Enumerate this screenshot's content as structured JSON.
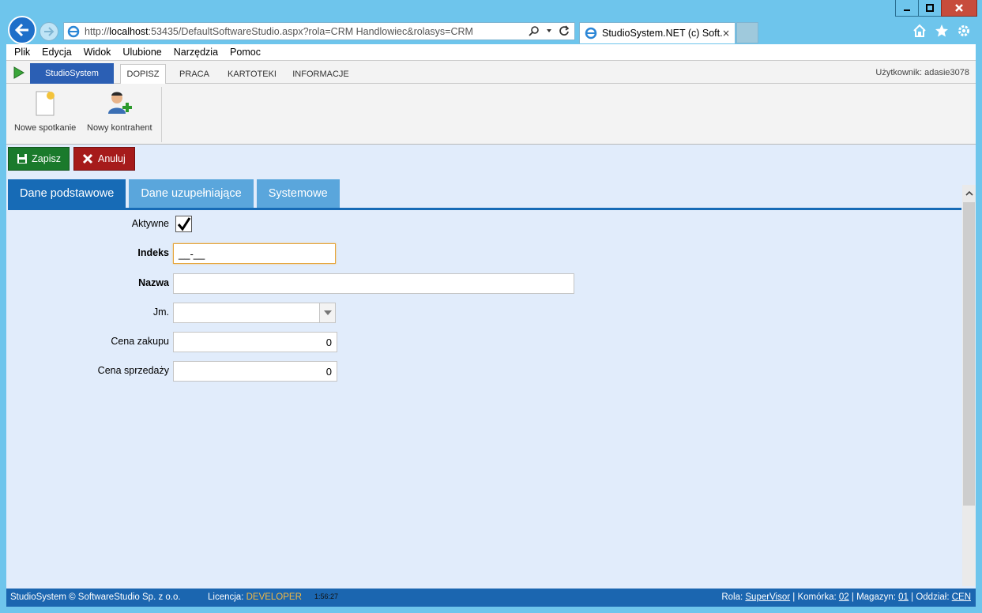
{
  "browser": {
    "url_prefix": "http://",
    "url_host": "localhost",
    "url_rest": ":53435/DefaultSoftwareStudio.aspx?rola=CRM Handlowiec&rolasys=CRM",
    "tab_title": "StudioSystem.NET (c) Soft...",
    "tab_close": "×"
  },
  "menu": [
    "Plik",
    "Edycja",
    "Widok",
    "Ulubione",
    "Narzędzia",
    "Pomoc"
  ],
  "ribbon": {
    "app_tab": "StudioSystem",
    "tabs": [
      "DOPISZ",
      "PRACA",
      "KARTOTEKI",
      "INFORMACJE"
    ],
    "user": "Użytkownik: adasie3078",
    "buttons": [
      "Nowe spotkanie",
      "Nowy kontrahent"
    ]
  },
  "actions": {
    "save": "Zapisz",
    "cancel": "Anuluj"
  },
  "form_tabs": [
    "Dane podstawowe",
    "Dane uzupełniające",
    "Systemowe"
  ],
  "form": {
    "active_label": "Aktywne",
    "index_label": "Indeks",
    "index_value": "__-__",
    "name_label": "Nazwa",
    "name_value": "",
    "unit_label": "Jm.",
    "unit_value": "",
    "buy_price_label": "Cena zakupu",
    "buy_price_value": "0",
    "sell_price_label": "Cena sprzedaży",
    "sell_price_value": "0"
  },
  "status": {
    "copyright": "StudioSystem © SoftwareStudio Sp. z o.o.",
    "license_label": "Licencja:",
    "license_value": "DEVELOPER",
    "clock": "1:56:27",
    "role_label": "Rola:",
    "role_value": "SuperVisor",
    "cell_label": "Komórka:",
    "cell_value": "02",
    "warehouse_label": "Magazyn:",
    "warehouse_value": "01",
    "branch_label": "Oddział:",
    "branch_value": "CEN"
  },
  "colors": {
    "save": "#1a7a2c",
    "cancel": "#a61b1b",
    "tab_active": "#176bb6",
    "tab_inactive": "#5aa6dc",
    "status_bar": "#1b66b0",
    "license": "#f4b942"
  }
}
